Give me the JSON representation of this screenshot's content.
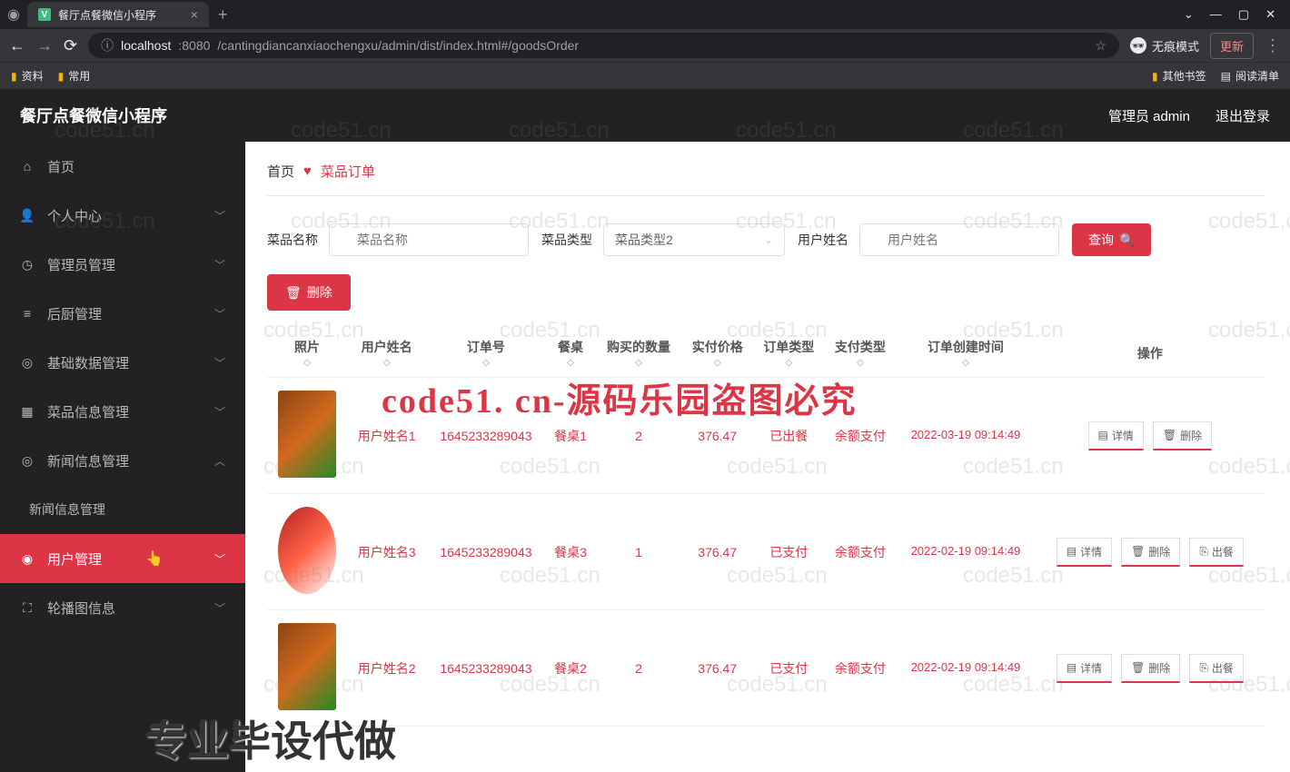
{
  "browser": {
    "tab_title": "餐厅点餐微信小程序",
    "url_host": "localhost",
    "url_port": ":8080",
    "url_path": "/cantingdiancanxiaochengxu/admin/dist/index.html#/goodsOrder",
    "incognito": "无痕模式",
    "update": "更新",
    "bookmarks": {
      "b1": "资料",
      "b2": "常用",
      "other": "其他书签",
      "reading": "阅读清单"
    }
  },
  "header": {
    "title": "餐厅点餐微信小程序",
    "user": "管理员 admin",
    "logout": "退出登录"
  },
  "sidebar": {
    "items": [
      {
        "icon": "⌂",
        "label": "首页",
        "chev": ""
      },
      {
        "icon": "👤",
        "label": "个人中心",
        "chev": "﹀"
      },
      {
        "icon": "◷",
        "label": "管理员管理",
        "chev": "﹀"
      },
      {
        "icon": "≡",
        "label": "后厨管理",
        "chev": "﹀"
      },
      {
        "icon": "◎",
        "label": "基础数据管理",
        "chev": "﹀"
      },
      {
        "icon": "▦",
        "label": "菜品信息管理",
        "chev": "﹀"
      },
      {
        "icon": "◎",
        "label": "新闻信息管理",
        "chev": "︿"
      },
      {
        "icon": "",
        "label": "新闻信息管理",
        "chev": "",
        "sub": true
      },
      {
        "icon": "◉",
        "label": "用户管理",
        "chev": "﹀",
        "active": true
      },
      {
        "icon": "⛶",
        "label": "轮播图信息",
        "chev": "﹀"
      }
    ]
  },
  "breadcrumb": {
    "home": "首页",
    "current": "菜品订单"
  },
  "search": {
    "dish_label": "菜品名称",
    "dish_ph": "菜品名称",
    "type_label": "菜品类型",
    "type_value": "菜品类型2",
    "user_label": "用户姓名",
    "user_ph": "用户姓名",
    "query_btn": "查询"
  },
  "delete_btn": "删除",
  "table": {
    "headers": [
      "照片",
      "用户姓名",
      "订单号",
      "餐桌",
      "购买的数量",
      "实付价格",
      "订单类型",
      "支付类型",
      "订单创建时间",
      "操作"
    ],
    "rows": [
      {
        "user": "用户姓名1",
        "order": "1645233289043",
        "desk": "餐桌1",
        "qty": "2",
        "price": "376.47",
        "otype": "已出餐",
        "ptype": "余额支付",
        "time": "2022-03-19 09:14:49",
        "actions": [
          "详情",
          "删除"
        ]
      },
      {
        "user": "用户姓名3",
        "order": "1645233289043",
        "desk": "餐桌3",
        "qty": "1",
        "price": "376.47",
        "otype": "已支付",
        "ptype": "余额支付",
        "time": "2022-02-19 09:14:49",
        "actions": [
          "详情",
          "删除",
          "出餐"
        ]
      },
      {
        "user": "用户姓名2",
        "order": "1645233289043",
        "desk": "餐桌2",
        "qty": "2",
        "price": "376.47",
        "otype": "已支付",
        "ptype": "余额支付",
        "time": "2022-02-19 09:14:49",
        "actions": [
          "详情",
          "删除",
          "出餐"
        ]
      }
    ]
  },
  "action_icons": {
    "详情": "▤",
    "删除": "🗑",
    "出餐": "⎘"
  },
  "watermark": {
    "small": "code51.cn",
    "big": "code51. cn-源码乐园盗图必究",
    "bottom": "专业毕设代做"
  }
}
